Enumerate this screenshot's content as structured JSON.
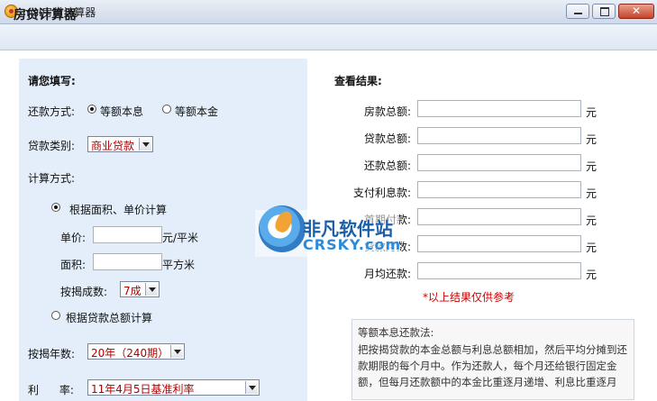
{
  "window": {
    "title": "msl房贷计算器"
  },
  "header": {
    "title": "房贷计算器"
  },
  "form": {
    "heading": "请您填写:",
    "repay_label": "还款方式:",
    "repay_opt1": "等额本息",
    "repay_opt2": "等额本金",
    "loan_type_label": "贷款类别:",
    "loan_type_value": "商业贷款",
    "calc_label": "计算方式:",
    "calc_opt1": "根据面积、单价计算",
    "unit_price_label": "单价:",
    "unit_price_unit": "元/平米",
    "area_label": "面积:",
    "area_unit": "平方米",
    "ratio_label": "按揭成数:",
    "ratio_value": "7成",
    "calc_opt2": "根据贷款总额计算",
    "years_label": "按揭年数:",
    "years_value": "20年（240期）",
    "rate_label": "利      率:",
    "rate_value": "11年4月5日基准利率"
  },
  "results": {
    "heading": "查看结果:",
    "currency": "元",
    "rows": [
      {
        "label": "房款总额:"
      },
      {
        "label": "贷款总额:"
      },
      {
        "label": "还款总额:"
      },
      {
        "label": "支付利息款:"
      },
      {
        "label": "首期付款:"
      },
      {
        "label": "贷款月数:"
      },
      {
        "label": "月均还款:"
      }
    ],
    "note": "*以上结果仅供参考"
  },
  "description": {
    "title": "等额本息还款法:",
    "text": "把按揭贷款的本金总额与利息总额相加，然后平均分摊到还款期限的每个月中。作为还款人，每个月还给银行固定金额，但每月还款额中的本金比重逐月递增、利息比重逐月"
  },
  "watermark": {
    "cn": "非凡软件站",
    "en": "CRSKY.com"
  }
}
